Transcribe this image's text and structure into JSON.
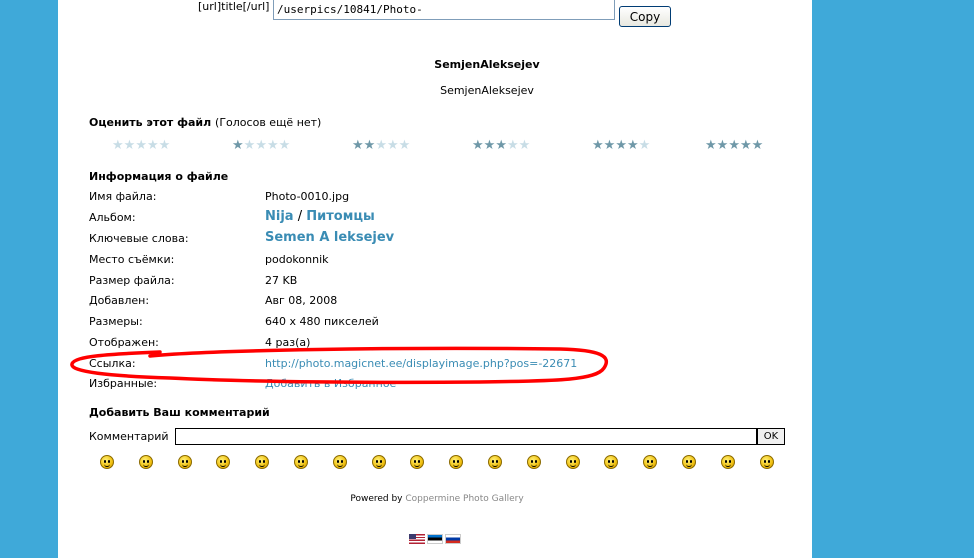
{
  "link": {
    "label": "[url]title[/url]",
    "value": "/userpics/10841/Photo-",
    "copy_label": "Copy"
  },
  "title": {
    "bold": "SemjenAleksejev",
    "plain": "SemjenAleksejev"
  },
  "rating": {
    "heading": "Оценить этот файл",
    "note": "(Голосов ещё нет)",
    "levels": [
      0,
      1,
      2,
      3,
      4,
      5
    ]
  },
  "info": {
    "heading": "Информация о файле",
    "rows": [
      {
        "label": "Имя файла:",
        "value": "Photo-0010.jpg"
      },
      {
        "label": "Альбом:",
        "link1": "Nija",
        "sep": " / ",
        "link2": "Питомцы"
      },
      {
        "label": "Ключевые слова:",
        "link1": "Semen A leksejev"
      },
      {
        "label": "Место съёмки:",
        "value": "podokonnik"
      },
      {
        "label": "Размер файла:",
        "value": "27 KB"
      },
      {
        "label": "Добавлен:",
        "value": "Авг 08, 2008"
      },
      {
        "label": "Размеры:",
        "value": "640 x 480 пикселей"
      },
      {
        "label": "Отображен:",
        "value": "4 раз(а)"
      },
      {
        "label": "Ссылка:",
        "link": "http://photo.magicnet.ee/displayimage.php?pos=-22671"
      },
      {
        "label": "Избранные:",
        "link": "Добавить в Избранное"
      }
    ]
  },
  "comment": {
    "heading": "Добавить Ваш комментарий",
    "label": "Комментарий",
    "value": "",
    "ok_label": "OK"
  },
  "smileys": [
    "smile",
    "biggrin",
    "grin",
    "happy",
    "neutral",
    "sad",
    "frown",
    "cool",
    "shock",
    "confused",
    "wink-shy",
    "eek",
    "rolleyes",
    "dizzy",
    "wink",
    "idea",
    "exclaim",
    "question"
  ],
  "footer": {
    "powered": "Powered by",
    "gallery": "Coppermine Photo Gallery"
  },
  "annotation": {
    "color": "#ff0000"
  }
}
